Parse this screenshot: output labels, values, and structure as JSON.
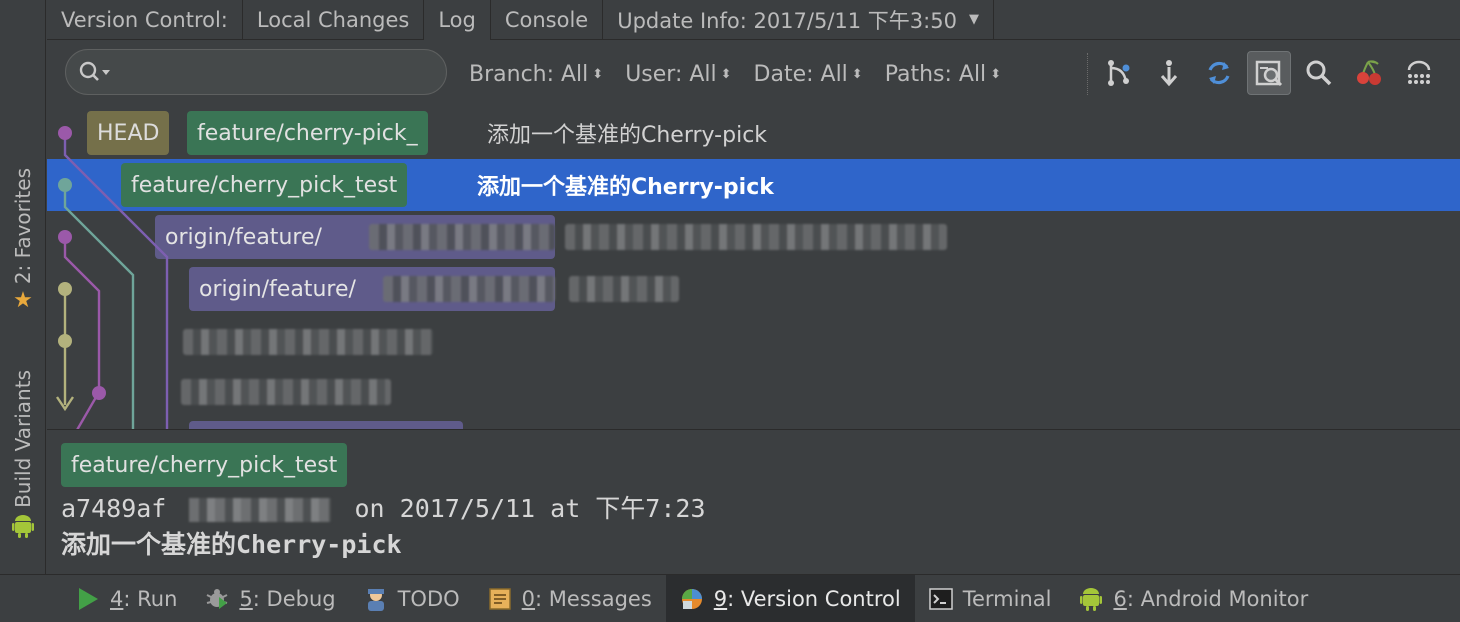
{
  "left_strip": {
    "favorites": {
      "label": "2: Favorites",
      "icon": "star-icon",
      "color": "#e9a93c"
    },
    "build_variants": {
      "label": "Build Variants",
      "icon": "android-icon",
      "color": "#a4c639"
    }
  },
  "header_tabs": [
    {
      "label": "Version Control:"
    },
    {
      "label": "Local Changes"
    },
    {
      "label": "Log"
    },
    {
      "label": "Console"
    },
    {
      "label": "Update Info: 2017/5/11 下午3:50"
    }
  ],
  "toolbar": {
    "search_value": "",
    "filters": [
      {
        "label": "Branch: All"
      },
      {
        "label": "User: All"
      },
      {
        "label": "Date: All"
      },
      {
        "label": "Paths: All"
      }
    ],
    "icons": [
      "branch-graph-icon",
      "down-arrow-icon",
      "refresh-icon",
      "preview-diff-icon",
      "search-icon",
      "cherry-pick-icon",
      "settings-icon"
    ]
  },
  "log_rows": [
    {
      "refs": [
        {
          "type": "head",
          "label": "HEAD"
        },
        {
          "type": "local",
          "label": "feature/cherry-pick_"
        }
      ],
      "message": "添加一个基准的Cherry-pick"
    },
    {
      "refs": [
        {
          "type": "local",
          "label": "feature/cherry_pick_test"
        }
      ],
      "message": "添加一个基准的Cherry-pick",
      "selected": true
    },
    {
      "refs": [
        {
          "type": "remote",
          "label": "origin/feature/"
        }
      ],
      "message": ""
    },
    {
      "refs": [
        {
          "type": "remote",
          "label": "origin/feature/"
        }
      ],
      "message": ""
    },
    {
      "refs": [],
      "message": ""
    },
    {
      "refs": [],
      "message": ""
    }
  ],
  "details": {
    "branch": "feature/cherry_pick_test",
    "hash": "a7489af",
    "meta": "on 2017/5/11 at 下午7:23",
    "subject": "添加一个基准的Cherry-pick"
  },
  "bottom_tabs": [
    {
      "num": "4",
      "rest": ": Run",
      "icon": "run-icon"
    },
    {
      "num": "5",
      "rest": ": Debug",
      "icon": "debug-icon"
    },
    {
      "num": "",
      "rest": "TODO",
      "icon": "todo-icon"
    },
    {
      "num": "0",
      "rest": ": Messages",
      "icon": "messages-icon"
    },
    {
      "num": "9",
      "rest": ": Version Control",
      "icon": "version-control-icon",
      "active": true
    },
    {
      "num": "",
      "rest": "Terminal",
      "icon": "terminal-icon"
    },
    {
      "num": "6",
      "rest": ": Android Monitor",
      "icon": "android-monitor-icon"
    }
  ],
  "colors": {
    "selection": "#2f65ca",
    "head_label": "#75704a",
    "local_label": "#3a7555",
    "remote_label": "#5f5b8a",
    "graph_purple": "#9b59a9",
    "graph_teal": "#6fa59a",
    "graph_olive": "#b3b27d",
    "graph_violet": "#7d5fb1"
  }
}
